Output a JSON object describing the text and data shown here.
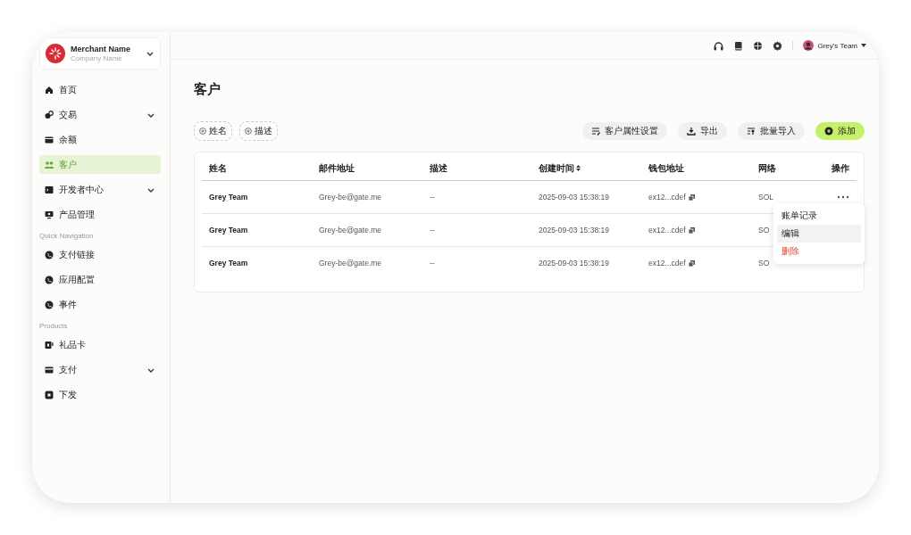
{
  "merchant": {
    "name": "Merchant Name",
    "company": "Company Name"
  },
  "sidebar": {
    "sections": [
      {
        "items": [
          {
            "label": "首页",
            "selected": false,
            "expandable": false
          },
          {
            "label": "交易",
            "selected": false,
            "expandable": true
          },
          {
            "label": "余额",
            "selected": false,
            "expandable": false
          },
          {
            "label": "客户",
            "selected": true,
            "expandable": false
          },
          {
            "label": "开发者中心",
            "selected": false,
            "expandable": true
          },
          {
            "label": "产品管理",
            "selected": false,
            "expandable": false
          }
        ]
      },
      {
        "heading": "Quick Navigation",
        "items": [
          {
            "label": "支付链接",
            "selected": false,
            "expandable": false
          },
          {
            "label": "应用配置",
            "selected": false,
            "expandable": false
          },
          {
            "label": "事件",
            "selected": false,
            "expandable": false
          }
        ]
      },
      {
        "heading": "Products",
        "items": [
          {
            "label": "礼品卡",
            "selected": false,
            "expandable": false
          },
          {
            "label": "支付",
            "selected": false,
            "expandable": true
          },
          {
            "label": "下发",
            "selected": false,
            "expandable": false
          }
        ]
      }
    ]
  },
  "topbar": {
    "user": "Grey's Team"
  },
  "page": {
    "title": "客户"
  },
  "filters": [
    "姓名",
    "描述"
  ],
  "actions": [
    {
      "label": "客户属性设置",
      "kind": "secondary"
    },
    {
      "label": "导出",
      "kind": "secondary"
    },
    {
      "label": "批量导入",
      "kind": "secondary"
    },
    {
      "label": "添加",
      "kind": "primary"
    }
  ],
  "table": {
    "columns": [
      {
        "label": "姓名",
        "sortable": false
      },
      {
        "label": "邮件地址",
        "sortable": false
      },
      {
        "label": "描述",
        "sortable": false
      },
      {
        "label": "创建时间",
        "sortable": true
      },
      {
        "label": "钱包地址",
        "sortable": false
      },
      {
        "label": "网络",
        "sortable": false
      },
      {
        "label": "操作",
        "sortable": false
      }
    ],
    "rows": [
      {
        "name": "Grey Team",
        "email": "Grey-be@gate.me",
        "description": "--",
        "created": "2025-09-03 15:38:19",
        "wallet": "ex12...cdef",
        "network": "SOL",
        "menu_button": true
      },
      {
        "name": "Grey Team",
        "email": "Grey-be@gate.me",
        "description": "--",
        "created": "2025-09-03 15:38:19",
        "wallet": "ex12...cdef",
        "network": "SO",
        "menu_button": false
      },
      {
        "name": "Grey Team",
        "email": "Grey-be@gate.me",
        "description": "--",
        "created": "2025-09-03 15:38:19",
        "wallet": "ex12...cdef",
        "network": "SO",
        "menu_button": false
      }
    ]
  },
  "row_menu": [
    {
      "label": "账单记录",
      "selected": false,
      "kind": "normal"
    },
    {
      "label": "编辑",
      "selected": true,
      "kind": "normal"
    },
    {
      "label": "删除",
      "selected": false,
      "kind": "danger"
    }
  ]
}
